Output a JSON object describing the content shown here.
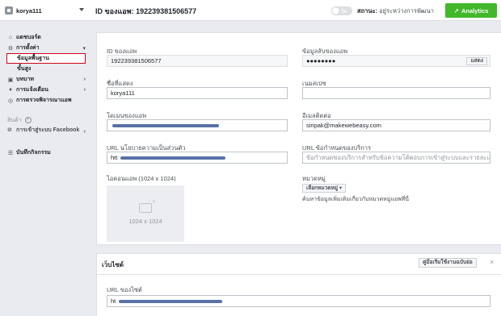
{
  "header": {
    "app_name": "korya111",
    "app_id_label": "ID ของแอพ: 192239381506577",
    "toggle_label": "ปิด",
    "status_prefix": "สถานะ:",
    "status_value": "อยู่ระหว่างการพัฒนา",
    "analytics_label": "Analytics",
    "analytics_icon": "trend-arrow-icon",
    "accent_color": "#42b72a"
  },
  "sidebar": {
    "items": [
      {
        "label": "แดชบอร์ด",
        "icon": "home-icon"
      },
      {
        "label": "การตั้งค่า",
        "icon": "gear-icon"
      },
      {
        "label": "ข้อมูลพื้นฐาน"
      },
      {
        "label": "ขั้นสูง"
      },
      {
        "label": "บทบาท",
        "icon": "roles-icon"
      },
      {
        "label": "การแจ้งเตือน",
        "icon": "bell-icon"
      },
      {
        "label": "การตรวจพิจารณาแอพ",
        "icon": "review-icon"
      }
    ],
    "products_label": "สินค้า",
    "fb_login_label": "การเข้าสู่ระบบ Facebook",
    "activity_log_label": "บันทึกกิจกรรม"
  },
  "form": {
    "app_id_label": "ID ของแอพ",
    "app_id_value": "192239381506577",
    "app_secret_label": "ข้อมูลลับของแอพ",
    "app_secret_value": "●●●●●●●●",
    "show_label": "แสดง",
    "display_name_label": "ชื่อที่แสดง",
    "display_name_value": "korya111",
    "namespace_label": "เนมสเปซ",
    "app_domains_label": "โดเมนของแอพ",
    "contact_email_label": "อีเมลติดต่อ",
    "contact_email_value": "siripak@makewebeasy.com",
    "privacy_url_label": "URL นโยบายความเป็นส่วนตัว",
    "privacy_url_value": "htt",
    "terms_url_label": "URL ข้อกำหนดของบริการ",
    "terms_url_placeholder": "ข้อกำหนดของบริการสำหรับข้อความโต้ตอบการเข้าสู่ระบบและรายละเอียด",
    "app_icon_label": "ไอคอนแอพ (1024 x 1024)",
    "app_icon_size": "1024 x 1024",
    "category_label": "หมวดหมู่",
    "category_button": "เลือกหมวดหมู่",
    "category_help": "ค้นหาข้อมูลเพิ่มเติมเกี่ยวกับหมวดหมู่แอพที่นี่"
  },
  "website": {
    "title": "เว็บไซต์",
    "quickstart_label": "คู่มือเริ่มใช้งานฉบับย่อ",
    "close_symbol": "×",
    "site_url_label": "URL ของไซต์",
    "site_url_value": "ht"
  }
}
